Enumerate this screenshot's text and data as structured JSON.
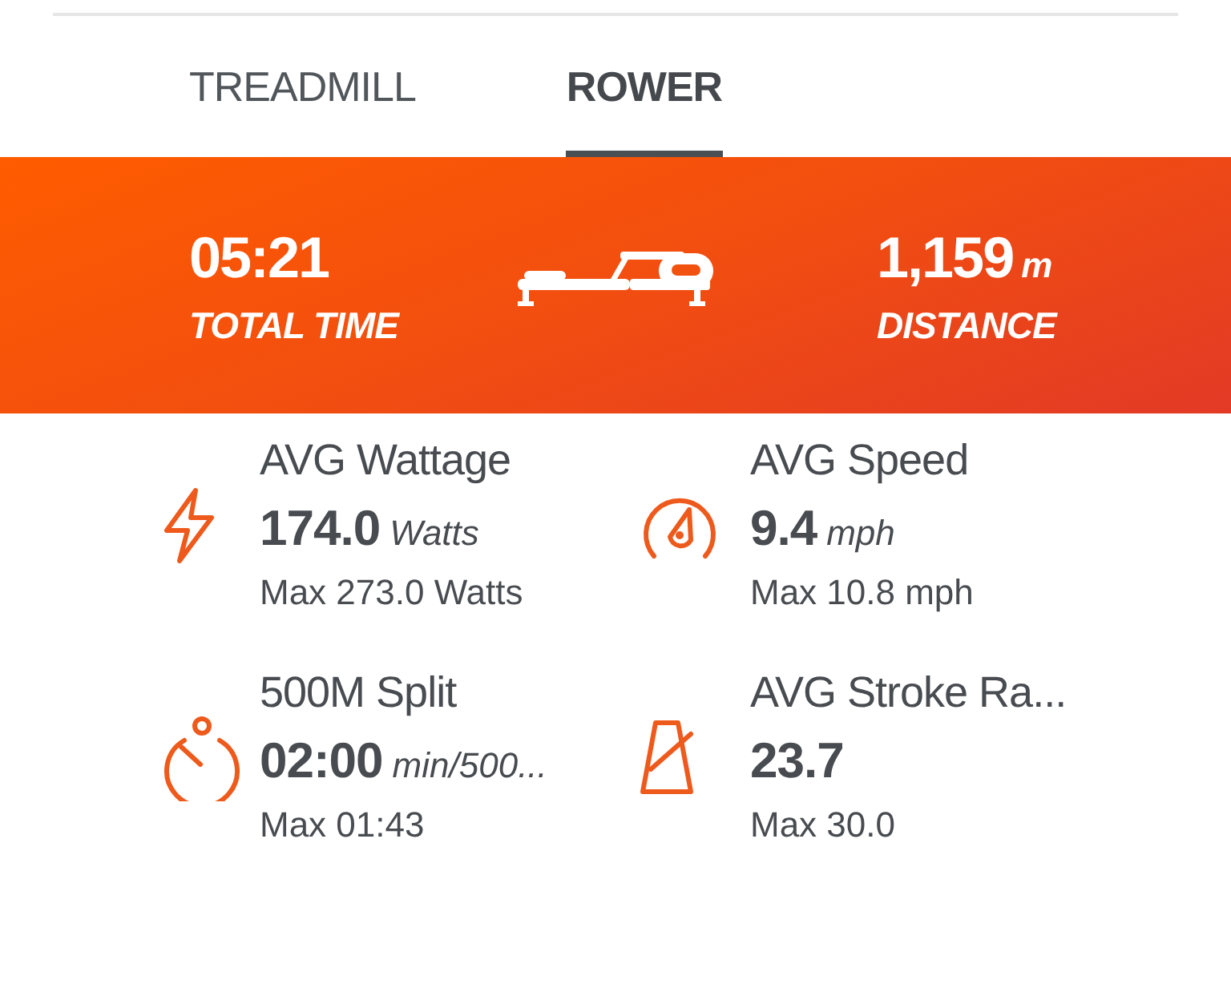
{
  "tabs": [
    {
      "label": "TREADMILL",
      "selected": false
    },
    {
      "label": "ROWER",
      "selected": true
    }
  ],
  "summary": [
    {
      "value": "05:21",
      "label": "TOTAL TIME"
    },
    {
      "value": "1,159",
      "unit": "m",
      "label": "DISTANCE"
    }
  ],
  "metrics": [
    {
      "title": "AVG Wattage",
      "value": "174.0",
      "unit": "Watts",
      "max": "Max 273.0 Watts"
    },
    {
      "title": "AVG Speed",
      "value": "9.4",
      "unit": "mph",
      "max": "Max 10.8 mph"
    },
    {
      "title": "500M Split",
      "value": "02:00",
      "unit": "min/500...",
      "max": "Max 01:43"
    },
    {
      "title": "AVG Stroke Ra...",
      "value": "23.7",
      "max": "Max 30.0"
    }
  ]
}
